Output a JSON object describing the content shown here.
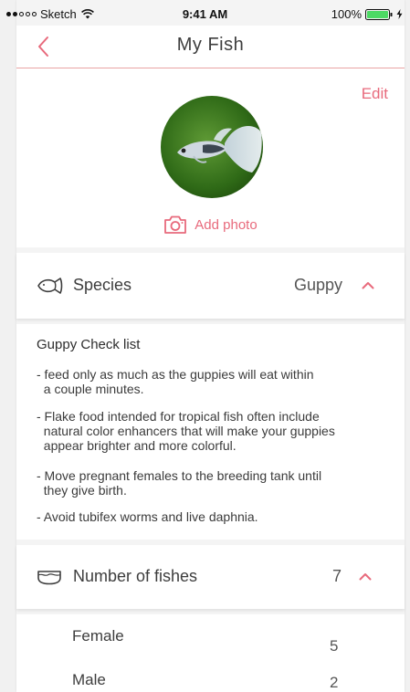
{
  "status_bar": {
    "carrier": "Sketch",
    "time": "9:41 AM",
    "battery": "100%"
  },
  "nav": {
    "title": "My Fish",
    "back_icon": "chevron-left-icon"
  },
  "profile": {
    "edit_label": "Edit",
    "add_photo_label": "Add photo"
  },
  "species": {
    "label": "Species",
    "value": "Guppy"
  },
  "checklist": {
    "title": "Guppy Check list",
    "items": [
      [
        "- feed only as much as the guppies will eat within",
        "  a couple minutes."
      ],
      [
        "- Flake food intended for tropical fish often include",
        "  natural color enhancers that will make your guppies",
        "  appear brighter and more colorful."
      ],
      [
        "- Move pregnant females to the breeding tank until",
        "  they give birth."
      ],
      [
        "- Avoid tubifex worms and live daphnia."
      ]
    ]
  },
  "fish_count": {
    "label": "Number of fishes",
    "value": "7"
  },
  "gender": {
    "female_label": "Female",
    "female_count": "5",
    "male_label": "Male",
    "male_count": "2"
  },
  "colors": {
    "accent": "#e86a7c",
    "divider": "#e9a3a3",
    "background": "#f4f4f4",
    "text": "#3d3d3d"
  }
}
